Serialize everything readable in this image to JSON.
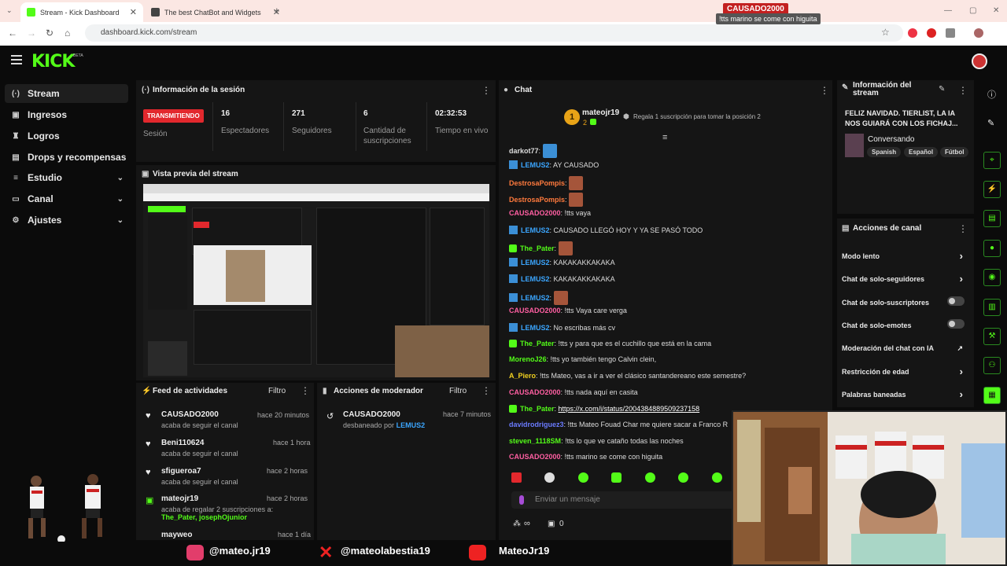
{
  "browser": {
    "tabs": [
      {
        "label": "Stream - Kick Dashboard",
        "active": true
      },
      {
        "label": "The best ChatBot and Widgets"
      }
    ],
    "url": "dashboard.kick.com/stream"
  },
  "overlay": {
    "username": "CAUSADO2000",
    "message": "!tts marino se come con higuita"
  },
  "app": {
    "logo": "KICK",
    "logo_badge": "BETA"
  },
  "sidebar": {
    "items": [
      {
        "label": "Stream",
        "icon": "radio-icon"
      },
      {
        "label": "Ingresos",
        "icon": "wallet-icon"
      },
      {
        "label": "Logros",
        "icon": "trophy-icon"
      },
      {
        "label": "Drops y recompensas",
        "icon": "gift-icon"
      },
      {
        "label": "Estudio",
        "icon": "sliders-icon"
      },
      {
        "label": "Canal",
        "icon": "monitor-icon"
      },
      {
        "label": "Ajustes",
        "icon": "gear-icon"
      }
    ]
  },
  "session": {
    "title": "Información de la sesión",
    "status": "TRANSMITIENDO",
    "status_label": "Sesión",
    "stats": [
      {
        "value": "16",
        "label": "Espectadores"
      },
      {
        "value": "271",
        "label": "Seguidores"
      },
      {
        "value": "6",
        "label": "Cantidad de suscripciones"
      },
      {
        "value": "02:32:53",
        "label": "Tiempo en vivo"
      }
    ]
  },
  "preview": {
    "title": "Vista previa del stream"
  },
  "feed": {
    "title": "Feed de actividades",
    "filter": "Filtro",
    "items": [
      {
        "name": "CAUSADO2000",
        "sub": "acaba de seguir el canal",
        "time": "hace 20 minutos"
      },
      {
        "name": "Beni110624",
        "sub": "acaba de seguir el canal",
        "time": "hace 1 hora"
      },
      {
        "name": "sfigueroa7",
        "sub": "acaba de seguir el canal",
        "time": "hace 2 horas"
      },
      {
        "name": "mateojr19",
        "sub": "acaba de regalar 2 suscripciones a:",
        "sub2": "The_Pater, josephOjunior",
        "time": "hace 2 horas"
      },
      {
        "name": "mayweo",
        "time": "hace 1 día"
      }
    ]
  },
  "moderator": {
    "title": "Acciones de moderador",
    "filter": "Filtro",
    "items": [
      {
        "name": "CAUSADO2000",
        "action": "desbaneado por",
        "by": "LEMUS2",
        "time": "hace 7 minutos"
      }
    ]
  },
  "chat": {
    "title": "Chat",
    "pinned_user": "mateojr19",
    "pinned_rank": "1",
    "pinned_count": "2",
    "pinned_text": "Regala 1 suscripción para tomar la posición 2",
    "messages": [
      {
        "user": "darkot77",
        "text": "",
        "color": "#dddddd"
      },
      {
        "user": "LEMUS2",
        "text": "AY CAUSADO",
        "color": "#3ba6ff"
      },
      {
        "user": "DestrosaPompis",
        "text": "",
        "color": "#ff7a3d"
      },
      {
        "user": "DestrosaPompis",
        "text": "",
        "color": "#ff7a3d"
      },
      {
        "user": "CAUSADO2000",
        "text": "!tts vaya",
        "color": "#ff5fa2"
      },
      {
        "user": "LEMUS2",
        "text": "CAUSADO LLEGÓ HOY Y YA SE PASÓ TODO",
        "color": "#3ba6ff"
      },
      {
        "user": "The_Pater",
        "text": "",
        "color": "#53fc18"
      },
      {
        "user": "LEMUS2",
        "text": "KAKAKAKKAKAKA",
        "color": "#3ba6ff"
      },
      {
        "user": "LEMUS2",
        "text": "KAKAKAKKAKAKA",
        "color": "#3ba6ff"
      },
      {
        "user": "LEMUS2",
        "text": "",
        "color": "#3ba6ff"
      },
      {
        "user": "CAUSADO2000",
        "text": "!tts Vaya care verga",
        "color": "#ff5fa2"
      },
      {
        "user": "LEMUS2",
        "text": "No escribas más cv",
        "color": "#3ba6ff"
      },
      {
        "user": "The_Pater",
        "text": "!tts y para que es el cuchillo que está en la cama",
        "color": "#53fc18"
      },
      {
        "user": "MorenoJ26",
        "text": "!tts yo también tengo Calvin clein,",
        "color": "#53fc18"
      },
      {
        "user": "A_Piero",
        "text": "!tts Mateo, vas a ir a ver el clásico santandereano este semestre?",
        "color": "#f0d020"
      },
      {
        "user": "CAUSADO2000",
        "text": "!tts nada aquí en casita",
        "color": "#ff5fa2"
      },
      {
        "user": "The_Pater",
        "text": "https://x.com/i/status/2004384889509237158",
        "color": "#53fc18"
      },
      {
        "user": "davidrodriguez3",
        "text": "!tts Mateo Fouad Char me quiere sacar a Franco R",
        "color": "#6a7bff"
      },
      {
        "user": "steven_1118SM",
        "text": "!tts lo que ve cataño todas las noches",
        "color": "#53fc18"
      },
      {
        "user": "CAUSADO2000",
        "text": "!tts marino se come con higuita",
        "color": "#ff5fa2"
      }
    ],
    "input_placeholder": "Enviar un mensaje",
    "footer_points": "∞",
    "footer_count": "0"
  },
  "stream_info": {
    "title": "Información del stream",
    "stream_title": "FELIZ NAVIDAD. TIERLIST, LA IA NOS GUIARÁ CON LOS FICHAJ...",
    "category": "Conversando",
    "tags": [
      "Spanish",
      "Español",
      "Fútbol"
    ]
  },
  "channel_actions": {
    "title": "Acciones de canal",
    "items": [
      {
        "label": "Modo lento",
        "control": "chevron"
      },
      {
        "label": "Chat de solo-seguidores",
        "control": "chevron"
      },
      {
        "label": "Chat de solo-suscriptores",
        "control": "toggle"
      },
      {
        "label": "Chat de solo-emotes",
        "control": "toggle"
      },
      {
        "label": "Moderación del chat con IA",
        "control": "external"
      },
      {
        "label": "Restricción de edad",
        "control": "chevron"
      },
      {
        "label": "Palabras baneadas",
        "control": "chevron"
      }
    ]
  },
  "socials": [
    {
      "handle": "@mateo.jr19",
      "icon": "instagram-icon"
    },
    {
      "handle": "@mateolabestia19",
      "icon": "x-icon"
    },
    {
      "handle": "MateoJr19",
      "icon": "youtube-icon"
    }
  ],
  "colors": {
    "accent": "#53fc18",
    "live": "#e2282d",
    "panel": "#151515",
    "bg": "#0b0b0b"
  }
}
